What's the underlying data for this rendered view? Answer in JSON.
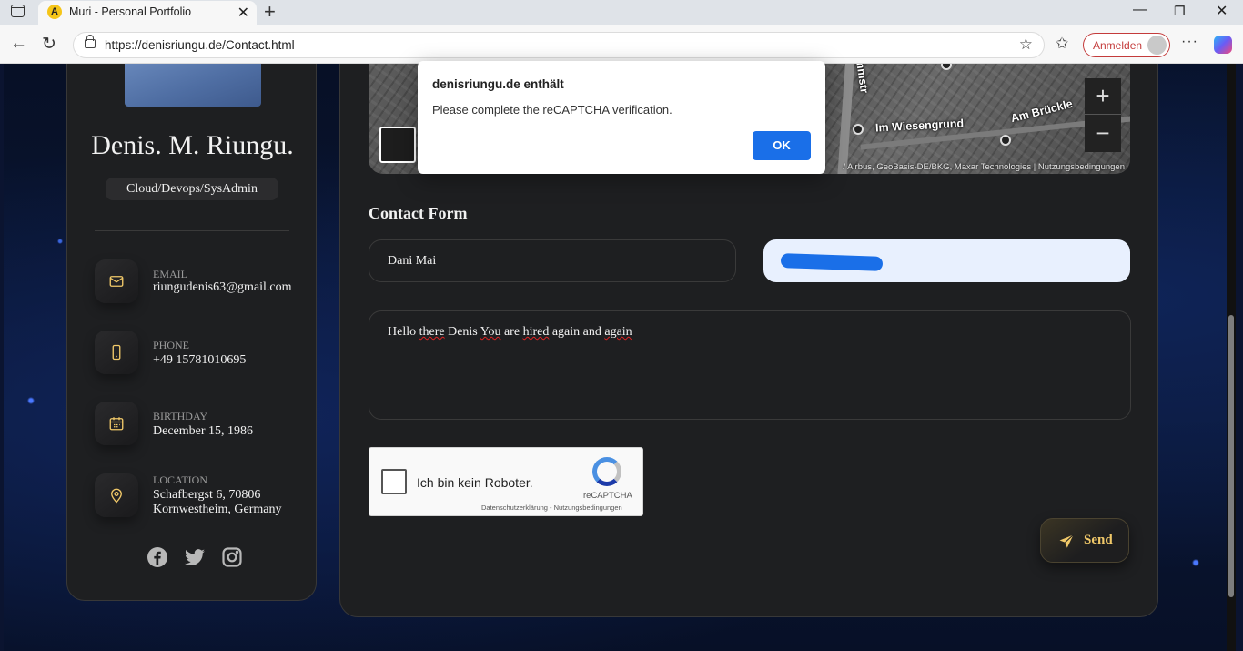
{
  "browser": {
    "tab_title": "Muri - Personal Portfolio",
    "url": "https://denisriungu.de/Contact.html",
    "signin_label": "Anmelden"
  },
  "sidebar": {
    "name": "Denis. M. Riungu.",
    "role": "Cloud/Devops/SysAdmin",
    "contacts": [
      {
        "label": "EMAIL",
        "value": "riungudenis63@gmail.com",
        "icon": "mail-icon"
      },
      {
        "label": "PHONE",
        "value": "+49 15781010695",
        "icon": "phone-icon"
      },
      {
        "label": "BIRTHDAY",
        "value": "December 15, 1986",
        "icon": "calendar-icon"
      },
      {
        "label": "LOCATION",
        "value": "Schafbergst 6, 70806",
        "value2": "Kornwestheim, Germany",
        "icon": "location-pin-icon"
      }
    ],
    "social": [
      "facebook-icon",
      "twitter-icon",
      "instagram-icon"
    ]
  },
  "map": {
    "labels": [
      "Lammstr",
      "Im Wiesengrund",
      "Am Brückle"
    ],
    "attribution": "/ Airbus, GeoBasis-DE/BKG, Maxar Technologies  |  Nutzungsbedingungen"
  },
  "contact_form": {
    "title": "Contact Form",
    "name_value": "Dani Mai",
    "message_parts": [
      "Hello ",
      "there",
      " Denis ",
      "You",
      " are ",
      "hired",
      " again and ",
      "again"
    ],
    "send_label": "Send"
  },
  "recaptcha": {
    "label": "Ich bin kein Roboter.",
    "brand": "reCAPTCHA",
    "links": "Datenschutzerklärung - Nutzungsbedingungen"
  },
  "dialog": {
    "title": "denisriungu.de enthält",
    "message": "Please complete the reCAPTCHA verification.",
    "ok_label": "OK"
  },
  "colors": {
    "accent": "#f1c969",
    "dialog_button": "#1a6fe8",
    "card": "#1e1f21"
  }
}
